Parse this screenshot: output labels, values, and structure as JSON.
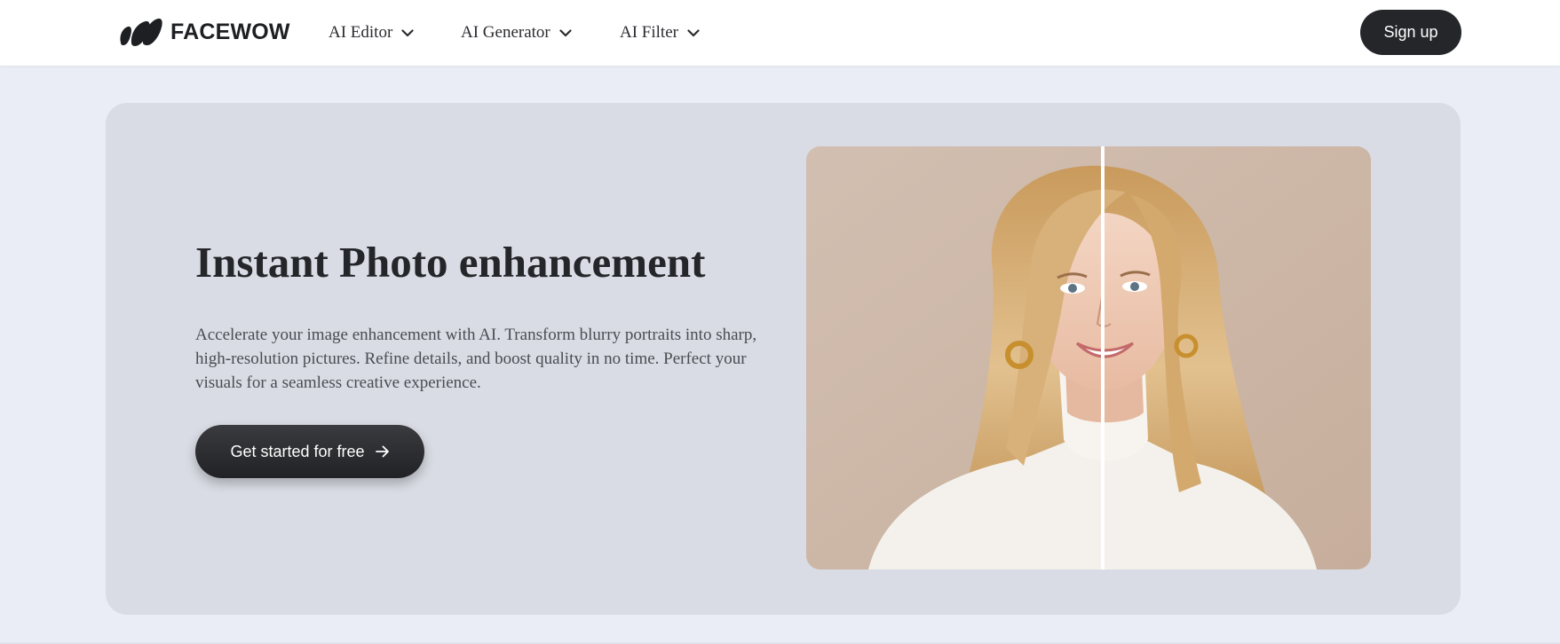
{
  "brand": {
    "name": "FACEWOW",
    "logo_icon": "facewow-logo-mark"
  },
  "nav": {
    "items": [
      {
        "label": "AI Editor",
        "icon": "chevron-down-icon"
      },
      {
        "label": "AI Generator",
        "icon": "chevron-down-icon"
      },
      {
        "label": "AI Filter",
        "icon": "chevron-down-icon"
      }
    ],
    "signup_label": "Sign up"
  },
  "hero": {
    "title": "Instant Photo enhancement",
    "description": "Accelerate your image enhancement with AI. Transform blurry portraits into sharp, high-resolution pictures. Refine details, and boost quality in no time. Perfect your visuals for a seamless creative experience.",
    "cta_label": "Get started for free",
    "cta_icon": "arrow-right-icon",
    "comparison_image": "before-after-portrait"
  },
  "colors": {
    "page_bg": "#eaedf5",
    "card_bg": "#d9dce4",
    "button_dark": "#25262a",
    "text_dark": "#25262a"
  }
}
